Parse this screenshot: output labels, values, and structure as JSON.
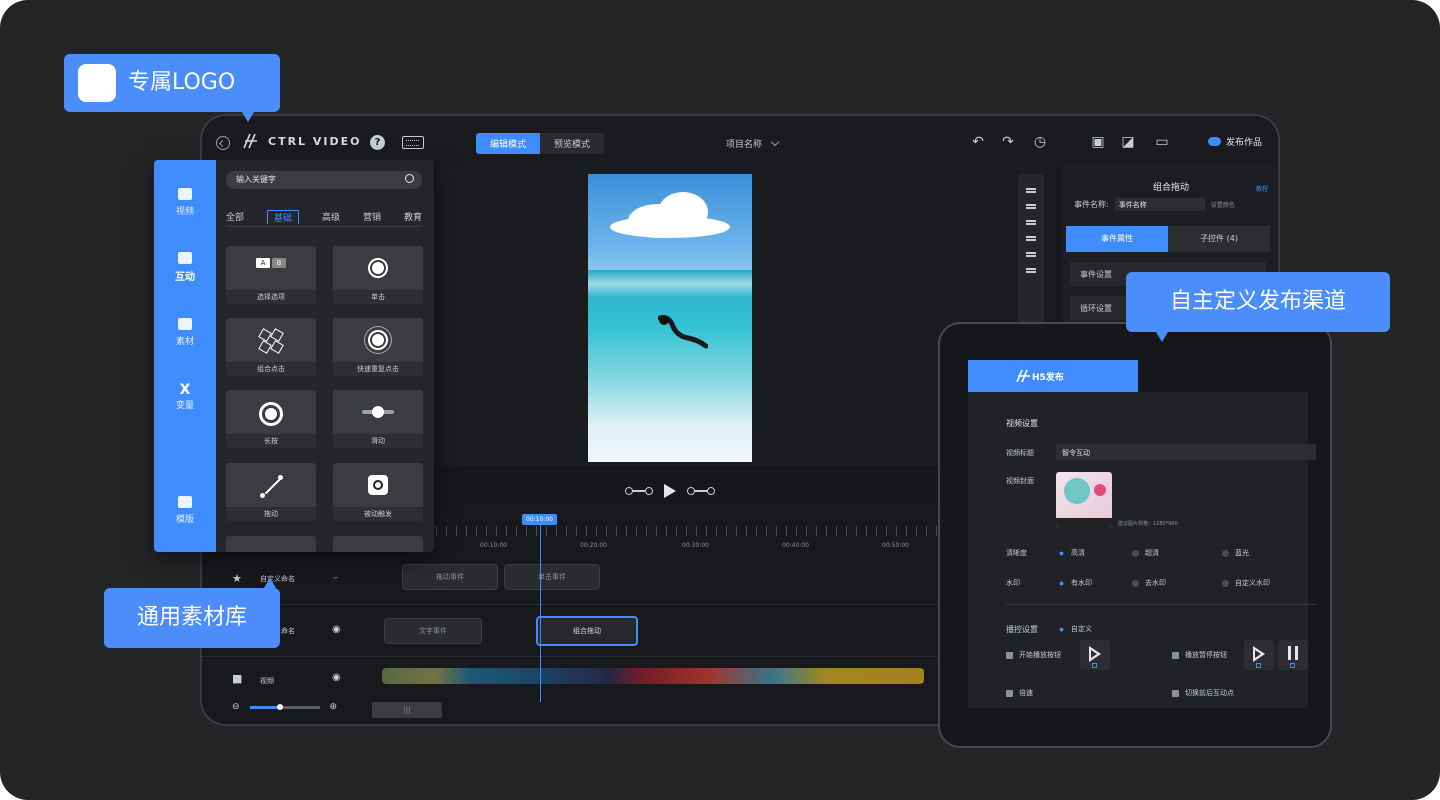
{
  "callouts": {
    "logo": "专属LOGO",
    "library": "通用素材库",
    "publish": "自主定义发布渠道"
  },
  "editor": {
    "brand": "CTRL VIDEO",
    "help_icon": "question-icon",
    "mode_tabs": [
      "编辑模式",
      "预览模式"
    ],
    "project_name": "项目名称",
    "publish_label": "发布作品"
  },
  "library": {
    "side": [
      "视频",
      "互动",
      "素材",
      "变量",
      "模版"
    ],
    "search_placeholder": "输入关键字",
    "tabs": [
      "全部",
      "基础",
      "高级",
      "营销",
      "教育"
    ],
    "active_tab": "基础",
    "cards": [
      "选择选项",
      "单击",
      "组合点击",
      "快速重复点击",
      "长按",
      "滑动",
      "拖动",
      "被动触发"
    ]
  },
  "properties": {
    "title": "组合拖动",
    "link": "教程",
    "event_name_label": "事件名称:",
    "event_name_value": "事件名称",
    "color_link": "设置颜色",
    "tabs": [
      "事件属性",
      "子控件 (4)"
    ],
    "rows": [
      "事件设置",
      "循环设置"
    ]
  },
  "timeline": {
    "playhead": "00:10:00",
    "ticks": [
      "00:10:00",
      "00:20:00",
      "00:30:00",
      "00:40:00",
      "00:50:00"
    ],
    "tracks": [
      "自定义命名",
      "自定义命名",
      "视频"
    ],
    "chips": [
      "拖动事件",
      "单击事件",
      "文字事件",
      "组合拖动"
    ]
  },
  "h5": {
    "header": "H5发布",
    "section_video": "视频设置",
    "title_label": "视频标题",
    "title_value": "智令互动",
    "cover_label": "视频封面",
    "cover_hint": "建议图片规格：1280*960",
    "quality_label": "清晰度",
    "quality_options": [
      "高清",
      "超清",
      "蓝光"
    ],
    "watermark_label": "水印",
    "watermark_options": [
      "有水印",
      "去水印",
      "自定义水印"
    ],
    "play_label": "播控设置",
    "play_custom": "自定义",
    "start_btn": "开始播放按钮",
    "pause_btn": "播放暂停按钮",
    "speed": "倍速",
    "switch": "切换前后互动点"
  },
  "colors": {
    "accent": "#3f8cff",
    "callout": "#4a8dfb",
    "bg": "#232527"
  }
}
